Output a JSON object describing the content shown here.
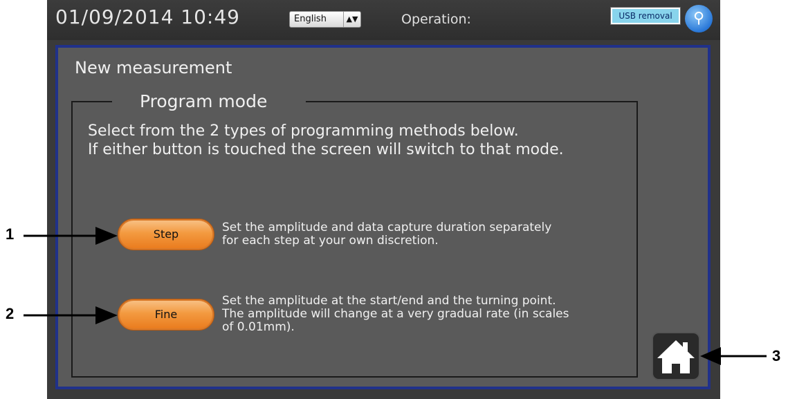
{
  "header": {
    "datetime": "01/09/2014  10:49",
    "language_value": "English",
    "operation_label": "Operation:",
    "usb_removal_label": "USB removal",
    "usb_icon": "usb-icon"
  },
  "panel": {
    "title": "New measurement",
    "group_title": "Program mode",
    "description_line1": "Select from the 2 types of programming methods below.",
    "description_line2": "If either button is touched the screen will switch to that mode."
  },
  "modes": [
    {
      "label": "Step",
      "desc_line1": "Set the amplitude and data capture duration separately",
      "desc_line2": "for each step at your own discretion."
    },
    {
      "label": "Fine",
      "desc_line1": "Set the amplitude at the start/end and the turning point.",
      "desc_line2": "The amplitude will change at a very gradual rate (in scales",
      "desc_line3": "of 0.01mm)."
    }
  ],
  "home_icon": "home-icon",
  "callouts": [
    "1",
    "2",
    "3"
  ],
  "colors": {
    "panel_border": "#20318a",
    "button_orange": "#f39a40",
    "usb_button": "#88d4ec"
  }
}
